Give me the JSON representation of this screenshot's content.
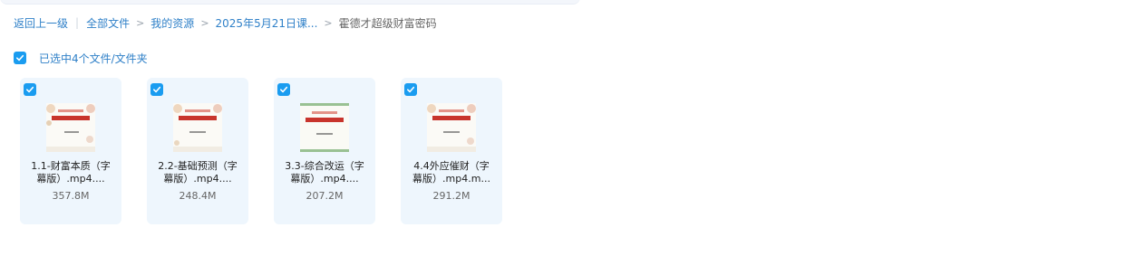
{
  "breadcrumb": {
    "back": "返回上一级",
    "items": [
      "全部文件",
      "我的资源",
      "2025年5月21日课..."
    ],
    "current": "霍德才超级财富密码",
    "separator": ">"
  },
  "selection": {
    "label": "已选中4个文件/文件夹"
  },
  "files": [
    {
      "name_line1": "1.1-财富本质（字",
      "name_line2": "幕版）.mp4....",
      "size": "357.8M"
    },
    {
      "name_line1": "2.2-基础预测（字",
      "name_line2": "幕版）.mp4....",
      "size": "248.4M"
    },
    {
      "name_line1": "3.3-综合改运（字",
      "name_line2": "幕版）.mp4....",
      "size": "207.2M"
    },
    {
      "name_line1": "4.4外应催财（字",
      "name_line2": "幕版）.mp4.m...",
      "size": "291.2M"
    }
  ],
  "colors": {
    "accent": "#1a9cf0",
    "link": "#2f80c8",
    "card_bg": "#eef6fd"
  },
  "icons": {
    "checkbox": "checkbox-checked-icon",
    "thumbnail": "video-thumbnail"
  }
}
